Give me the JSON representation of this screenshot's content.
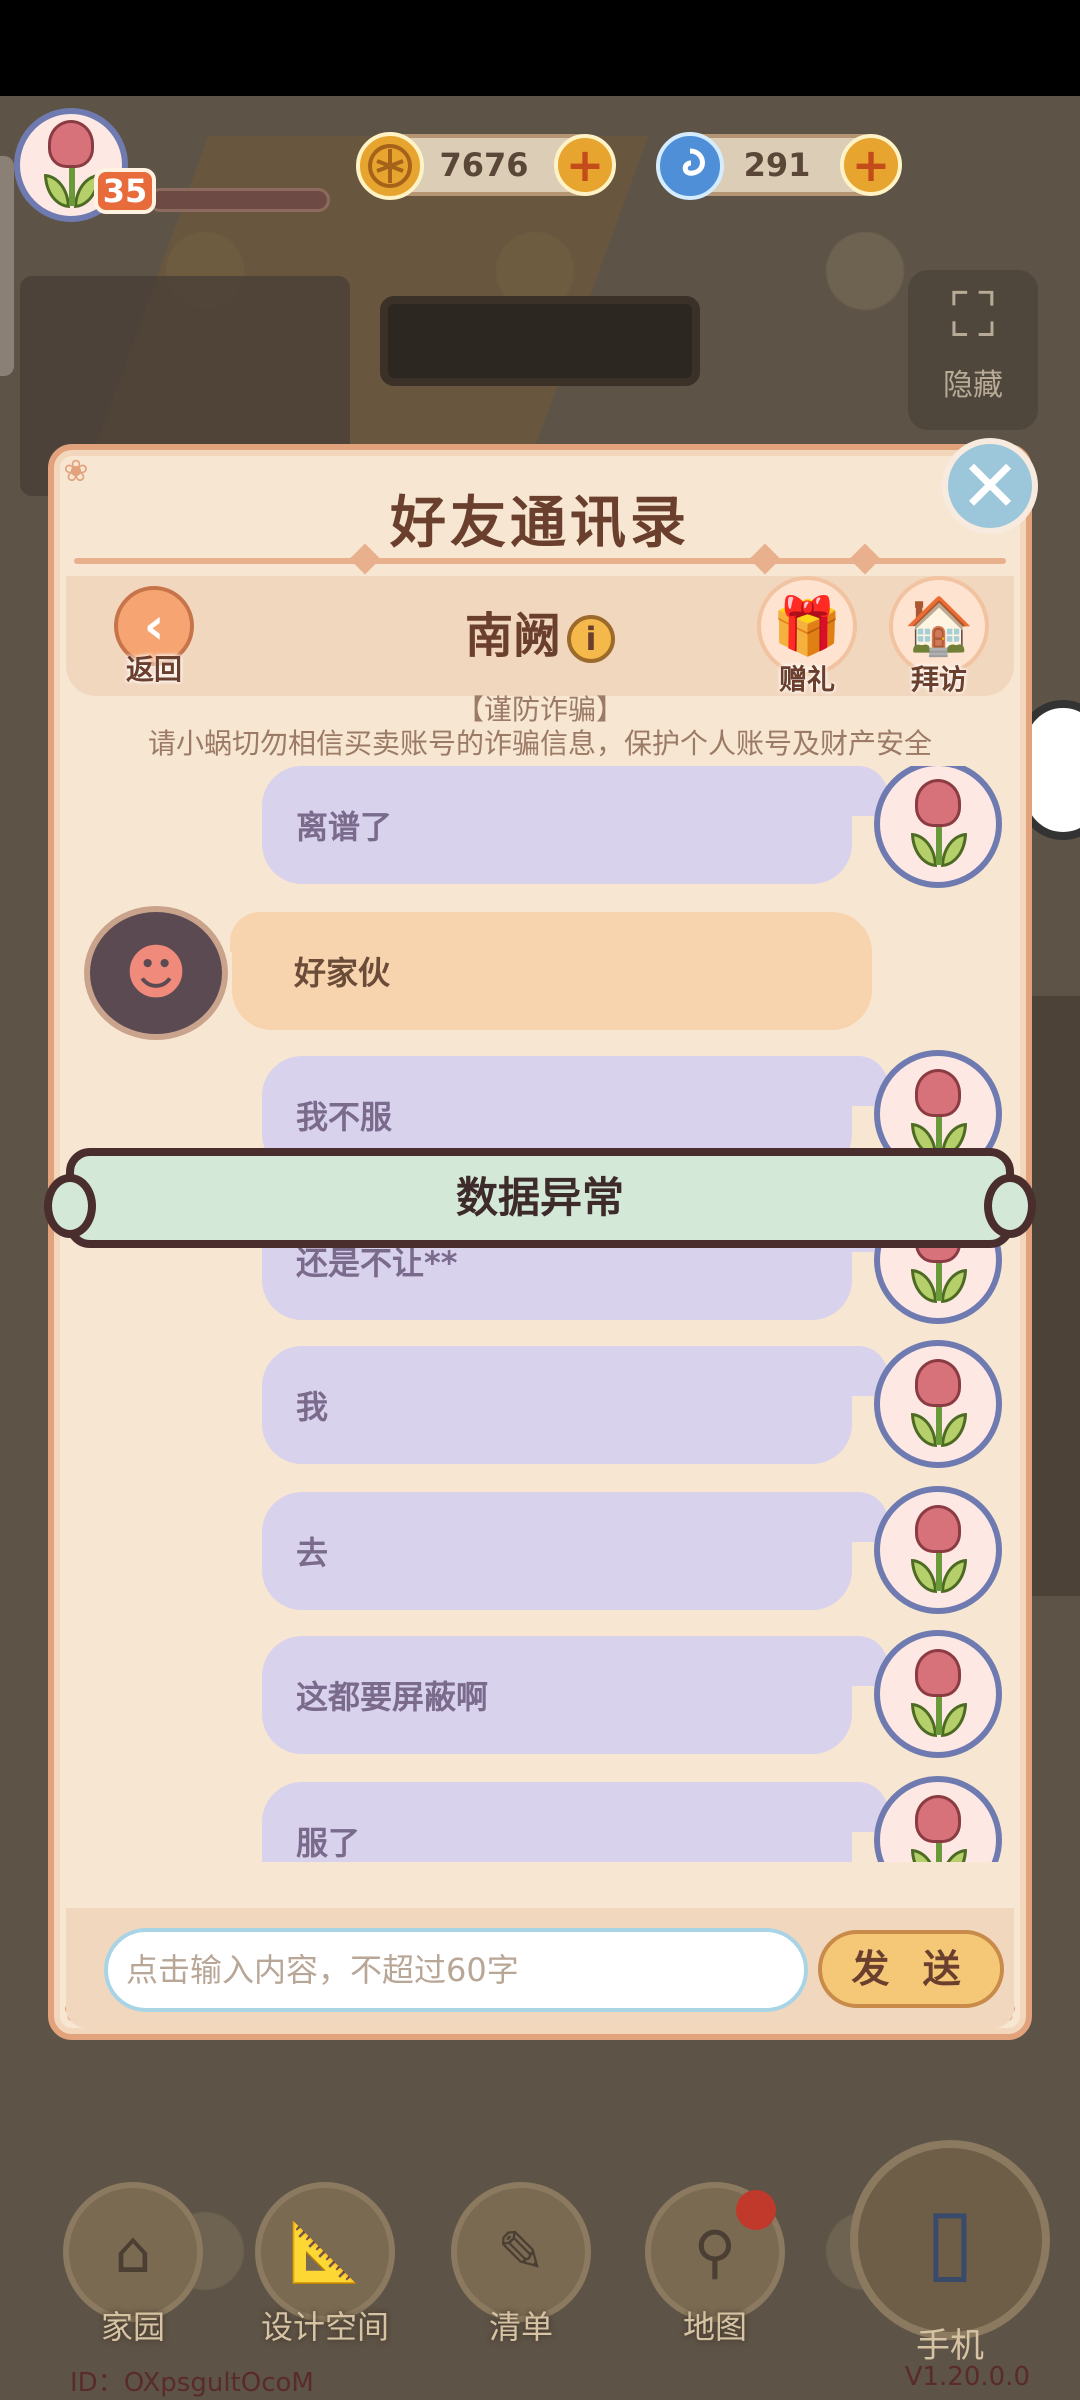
{
  "hud": {
    "level": "35",
    "coins": "7676",
    "gems": "291",
    "hide_label": "隐藏"
  },
  "panel": {
    "title": "好友通讯录",
    "friend_name": "南阙",
    "back_label": "返回",
    "gift_label": "赠礼",
    "visit_label": "拜访",
    "warning_title": "【谨防诈骗】",
    "warning_text": "请小蜗切勿相信买卖账号的诈骗信息，保护个人账号及财产安全"
  },
  "messages": [
    {
      "from": "self",
      "text": "离谱了"
    },
    {
      "from": "friend",
      "text": "好家伙"
    },
    {
      "from": "self",
      "text": "我不服"
    },
    {
      "from": "self",
      "text": "还是不让**"
    },
    {
      "from": "self",
      "text": "我"
    },
    {
      "from": "self",
      "text": "去"
    },
    {
      "from": "self",
      "text": "这都要屏蔽啊"
    },
    {
      "from": "self",
      "text": "服了"
    }
  ],
  "error_banner": "数据异常",
  "input": {
    "placeholder": "点击输入内容，不超过60字",
    "send_label": "发 送"
  },
  "bottom_nav": {
    "home": "家园",
    "design": "设计空间",
    "list": "清单",
    "map": "地图",
    "phone": "手机"
  },
  "footer": {
    "id_text": "ID：OXpsgultOcoM",
    "version": "V1.20.0.0"
  },
  "colors": {
    "panel_bg": "#f7e7d2",
    "self_bubble": "#d8d2ec",
    "friend_bubble": "#f7d3ae",
    "banner_bg": "#d4e8d8",
    "accent": "#e1a27c"
  }
}
